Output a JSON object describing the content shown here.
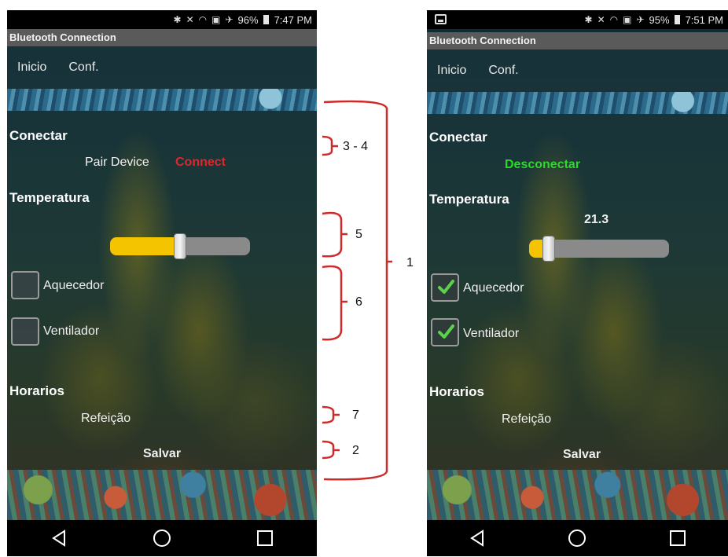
{
  "colors": {
    "connect_red": "#e0262b",
    "disconnect_green": "#2bd82b",
    "slider_fill": "#f4c400",
    "bracket_red": "#cf2a2a",
    "check_green": "#5bd24a"
  },
  "left_screen": {
    "status": {
      "battery": "96%",
      "time": "7:47 PM"
    },
    "app_title": "Bluetooth Connection",
    "tabs": [
      "Inicio",
      "Conf."
    ],
    "sections": {
      "connect": "Conectar",
      "temperature": "Temperatura",
      "schedules": "Horarios"
    },
    "pair_device": "Pair Device",
    "connect_button": "Connect",
    "slider_level": 0.5,
    "checkboxes": [
      {
        "label": "Aquecedor",
        "checked": false
      },
      {
        "label": "Ventilador",
        "checked": false
      }
    ],
    "meal": "Refeição",
    "save_button": "Salvar"
  },
  "right_screen": {
    "status": {
      "battery": "95%",
      "time": "7:51 PM"
    },
    "app_title": "Bluetooth Connection",
    "tabs": [
      "Inicio",
      "Conf."
    ],
    "sections": {
      "connect": "Conectar",
      "temperature": "Temperatura",
      "schedules": "Horarios"
    },
    "disconnect_button": "Desconectar",
    "temperature_value": "21.3",
    "slider_level": 0.14,
    "checkboxes": [
      {
        "label": "Aquecedor",
        "checked": true
      },
      {
        "label": "Ventilador",
        "checked": true
      }
    ],
    "meal": "Refeição",
    "save_button": "Salvar"
  },
  "annotations": {
    "labels": [
      "1",
      "2",
      "3 - 4",
      "5",
      "6",
      "7"
    ]
  },
  "icons": {
    "status": [
      "bluetooth-icon",
      "mute-icon",
      "wifi-icon",
      "nfc-icon",
      "airplane-icon",
      "battery-icon"
    ],
    "nav": [
      "back-icon",
      "home-icon",
      "recent-apps-icon"
    ],
    "check": "check-icon",
    "gallery": "image-notification-icon"
  }
}
